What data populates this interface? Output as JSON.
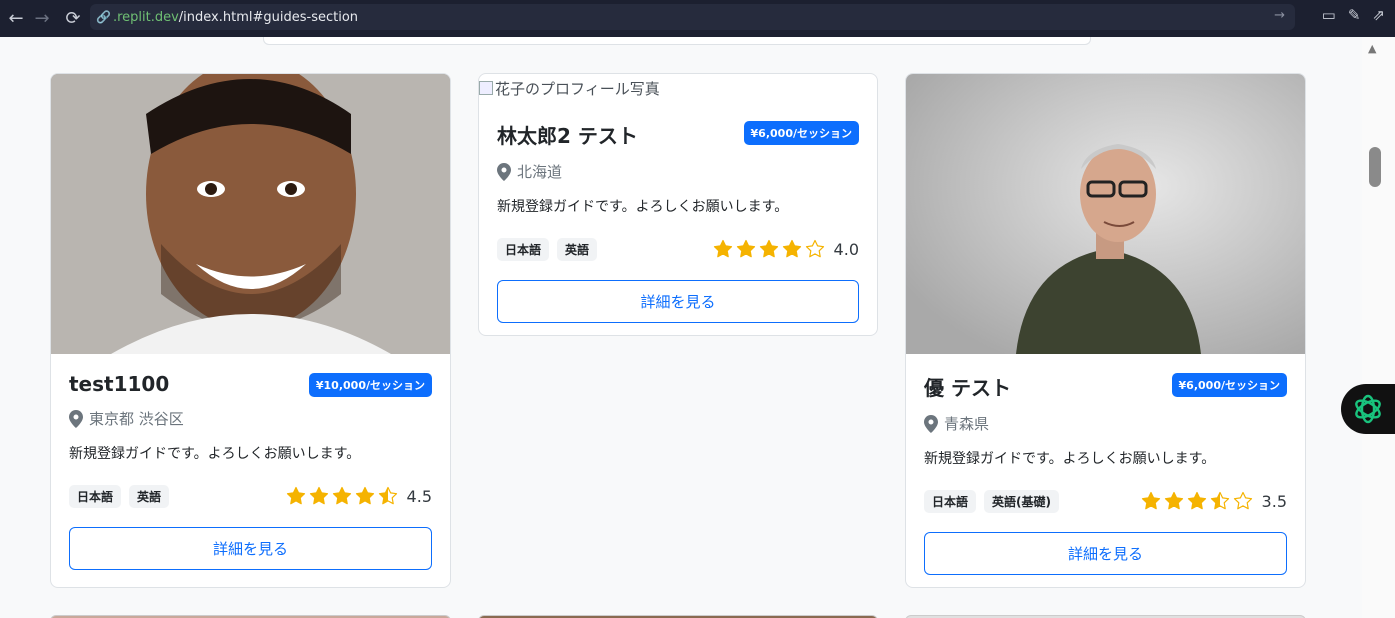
{
  "browser": {
    "url_host": ".replit.dev",
    "url_path": "/index.html#guides-section"
  },
  "cards": [
    {
      "name": "test1100",
      "price": "¥10,000/セッション",
      "location": "東京都 渋谷区",
      "description": "新規登録ガイドです。よろしくお願いします。",
      "languages": [
        "日本語",
        "英語"
      ],
      "rating": 4.5,
      "rating_text": "4.5",
      "button": "詳細を見る"
    },
    {
      "image_alt": "花子のプロフィール写真",
      "name": "林太郎2 テスト",
      "price": "¥6,000/セッション",
      "location": "北海道",
      "description": "新規登録ガイドです。よろしくお願いします。",
      "languages": [
        "日本語",
        "英語"
      ],
      "rating": 4.0,
      "rating_text": "4.0",
      "button": "詳細を見る"
    },
    {
      "name": "優 テスト",
      "price": "¥6,000/セッション",
      "location": "青森県",
      "description": "新規登録ガイドです。よろしくお願いします。",
      "languages": [
        "日本語",
        "英語(基礎)"
      ],
      "rating": 3.5,
      "rating_text": "3.5",
      "button": "詳細を見る"
    }
  ],
  "colors": {
    "primary": "#0d6efd",
    "star": "#f5b301"
  }
}
